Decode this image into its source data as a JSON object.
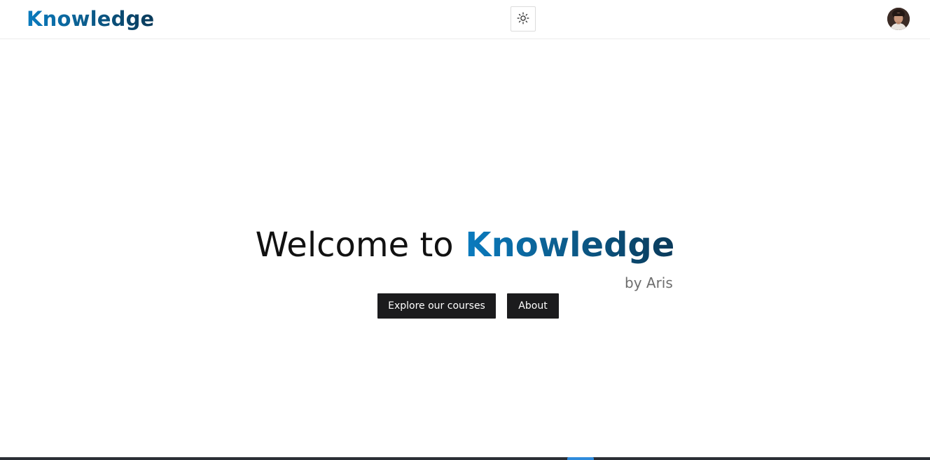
{
  "header": {
    "brand": "Knowledge",
    "theme_toggle_icon": "sun-icon",
    "avatar_icon": "user-avatar"
  },
  "hero": {
    "title_prefix": "Welcome to",
    "title_brand": "Knowledge",
    "byline": "by Aris",
    "buttons": {
      "explore_label": "Explore our courses",
      "about_label": "About"
    }
  },
  "colors": {
    "brand_gradient_start": "#0a7bbf",
    "brand_gradient_end": "#0a3a5a",
    "button_background": "#1b1b1d",
    "button_text": "#ffffff",
    "byline_text": "#6d6d6d"
  }
}
